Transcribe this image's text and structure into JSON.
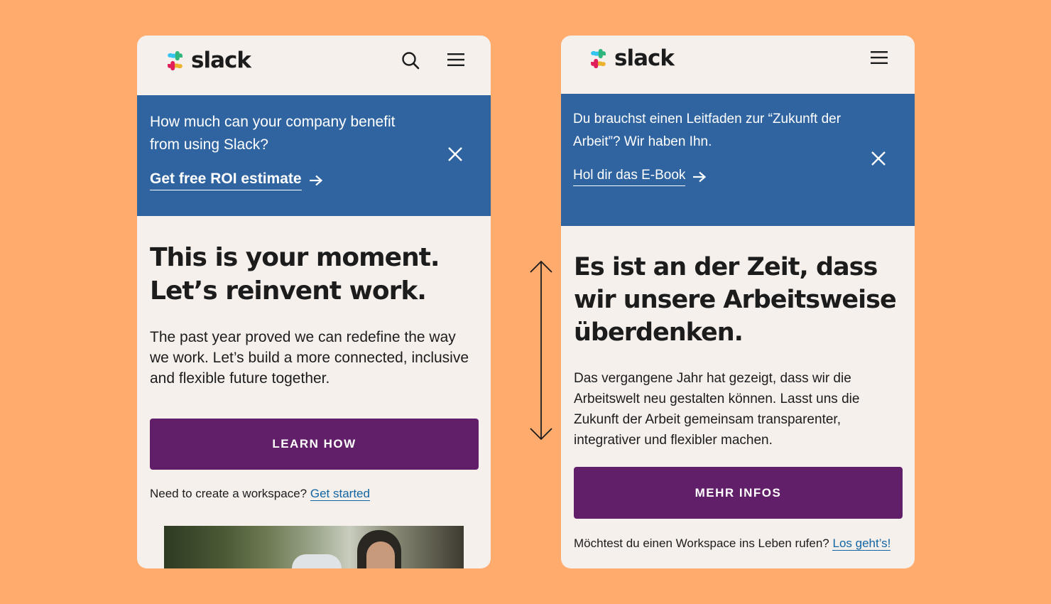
{
  "brand": {
    "name": "slack"
  },
  "english": {
    "banner": {
      "text": "How much can your company benefit from using Slack?",
      "link": "Get free ROI estimate"
    },
    "headline": "This is your moment. Let’s reinvent work.",
    "body": "The past year proved we can redefine the way we work. Let’s build a more connected, inclusive and flexible future together.",
    "cta": "LEARN HOW",
    "workspace_prompt": "Need to create a workspace?",
    "workspace_link": "Get started"
  },
  "german": {
    "banner": {
      "text": "Du brauchst einen Leitfaden zur “Zukunft der Arbeit”? Wir haben Ihn.",
      "link": "Hol dir das E-Book"
    },
    "headline": "Es ist an der Zeit, dass wir unsere Arbeitsweise überdenken.",
    "body": "Das vergangene Jahr hat gezeigt, dass wir die Arbeitswelt neu gestalten können. Lasst uns die Zukunft der Arbeit gemeinsam transparenter, integrativer und flexibler machen.",
    "cta": "MEHR INFOS",
    "workspace_prompt": "Möchtest du einen Workspace ins Leben rufen?",
    "workspace_link": "Los geht’s!"
  },
  "colors": {
    "background": "#FFAB6E",
    "page": "#F5F0EC",
    "banner": "#2F64A0",
    "cta": "#611F69",
    "link": "#1264A3",
    "text": "#1D1C1D"
  },
  "icons": [
    "slack-logo-icon",
    "search-icon",
    "hamburger-menu-icon",
    "close-icon",
    "arrow-right-icon",
    "double-arrow-vertical-icon"
  ]
}
